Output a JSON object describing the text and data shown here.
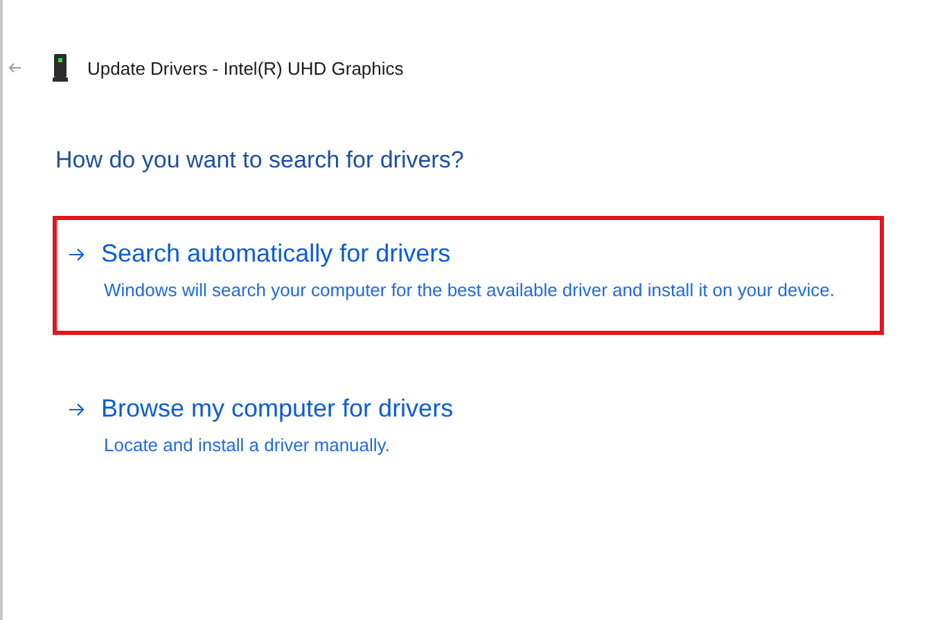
{
  "window": {
    "title": "Update Drivers - Intel(R) UHD Graphics"
  },
  "heading": "How do you want to search for drivers?",
  "options": [
    {
      "title": "Search automatically for drivers",
      "description": "Windows will search your computer for the best available driver and install it on your device.",
      "highlighted": true
    },
    {
      "title": "Browse my computer for drivers",
      "description": "Locate and install a driver manually.",
      "highlighted": false
    }
  ]
}
